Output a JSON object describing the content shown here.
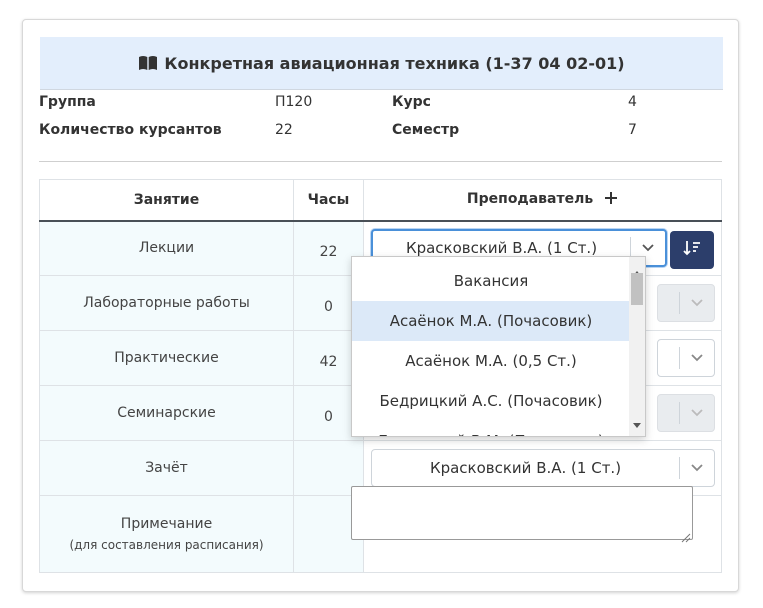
{
  "title": "Конкретная авиационная техника (1-37 04 02-01)",
  "info": {
    "group_label": "Группа",
    "group_value": "П120",
    "course_label": "Курс",
    "course_value": "4",
    "cadets_label": "Количество курсантов",
    "cadets_value": "22",
    "semester_label": "Семестр",
    "semester_value": "7"
  },
  "table": {
    "headers": {
      "lesson": "Занятие",
      "hours": "Часы",
      "teacher": "Преподаватель"
    },
    "rows": [
      {
        "lesson": "Лекции",
        "hours": "22",
        "teacher": "Красковский В.А. (1 Ст.)"
      },
      {
        "lesson": "Лабораторные работы",
        "hours": "0",
        "teacher": ""
      },
      {
        "lesson": "Практические",
        "hours": "42",
        "teacher": ""
      },
      {
        "lesson": "Семинарские",
        "hours": "0",
        "teacher": ""
      },
      {
        "lesson": "Зачёт",
        "hours": "",
        "teacher": "Красковский В.А. (1 Ст.)"
      }
    ],
    "note_label": "Примечание",
    "note_sub": "(для составления расписания)",
    "note_value": ""
  },
  "dropdown": {
    "options": [
      "Вакансия",
      "Асаёнок М.А. (Почасовик)",
      "Асаёнок М.А. (0,5 Ст.)",
      "Бедрицкий А.С. (Почасовик)",
      "Бедрицкий В.М. (Почасовик)"
    ],
    "highlighted": "Асаёнок М.А. (Почасовик)"
  },
  "colors": {
    "title_bg": "#e3eefc",
    "row_bg": "#f3fbfd",
    "sort_button": "#2c3e6b",
    "active_border": "#4a90d9",
    "highlight": "#dce9f8"
  },
  "icons": [
    "book-icon",
    "plus-icon",
    "chevron-down-icon",
    "sort-icon",
    "scroll-up-icon",
    "scroll-down-icon",
    "resize-grip-icon"
  ]
}
